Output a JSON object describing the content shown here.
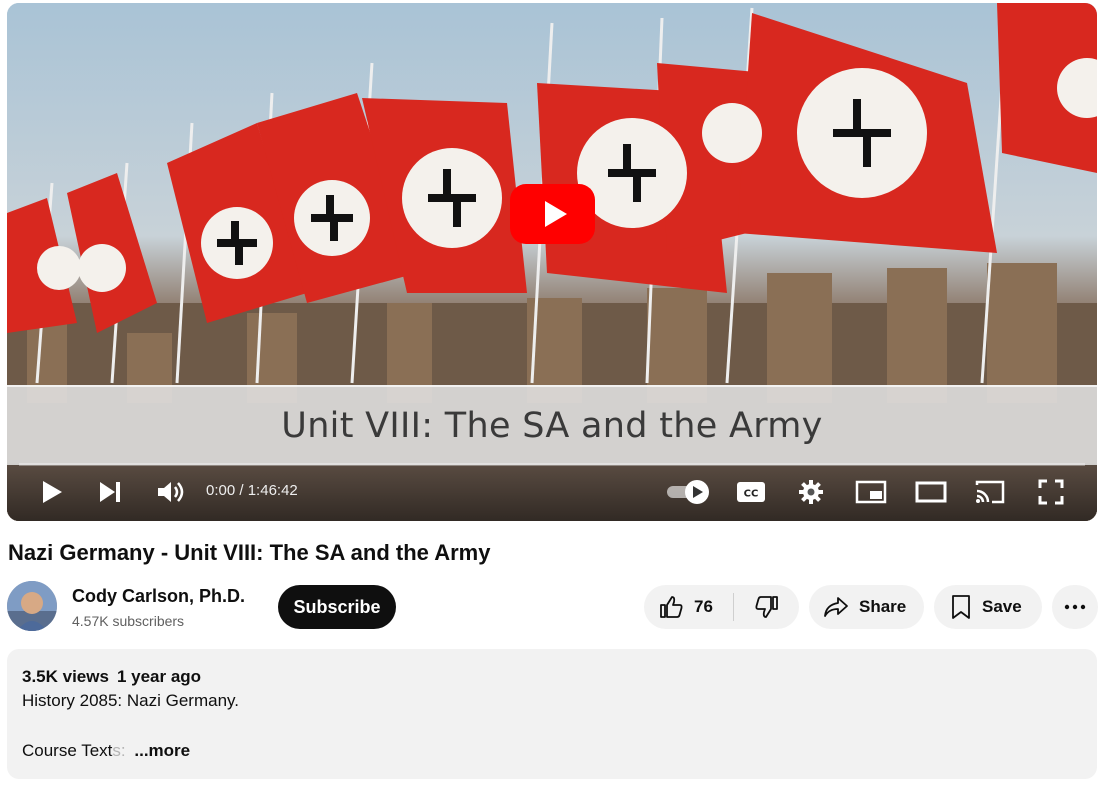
{
  "player": {
    "caption": "Unit VIII: The SA and the Army",
    "time_current": "0:00",
    "time_separator": " / ",
    "time_total": "1:46:42"
  },
  "video": {
    "title": "Nazi Germany - Unit VIII: The SA and the Army"
  },
  "channel": {
    "name": "Cody Carlson, Ph.D.",
    "subscribers": "4.57K subscribers",
    "subscribe_label": "Subscribe"
  },
  "actions": {
    "like_count": "76",
    "share_label": "Share",
    "save_label": "Save"
  },
  "description": {
    "views": "3.5K views",
    "age": "1 year ago",
    "line1": "History 2085: Nazi Germany.",
    "line2_visible": "Course Text",
    "line2_faded": "s:",
    "more_label": "...more"
  },
  "colors": {
    "brand_red": "#ff0000",
    "subscribe_bg": "#0f0f0f",
    "pill_bg": "#f2f2f2"
  }
}
